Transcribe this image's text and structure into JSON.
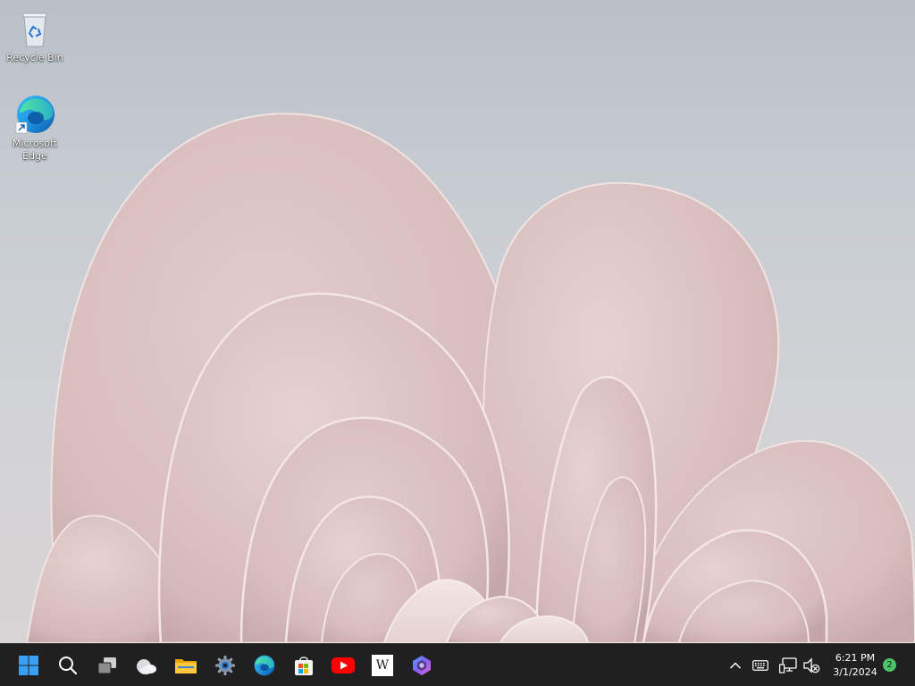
{
  "desktop": {
    "icons": [
      {
        "label": "Recycle Bin",
        "icon": "recycle-bin-icon"
      },
      {
        "label": "Microsoft Edge",
        "icon": "edge-icon"
      }
    ]
  },
  "taskbar": {
    "pinned": [
      {
        "name": "Start",
        "icon": "windows-start-icon"
      },
      {
        "name": "Search",
        "icon": "search-icon"
      },
      {
        "name": "Task View",
        "icon": "task-view-icon"
      },
      {
        "name": "Widgets",
        "icon": "weather-widget-icon"
      },
      {
        "name": "File Explorer",
        "icon": "folder-icon"
      },
      {
        "name": "Settings",
        "icon": "gear-icon"
      },
      {
        "name": "Microsoft Edge",
        "icon": "edge-icon"
      },
      {
        "name": "Microsoft Store",
        "icon": "store-icon"
      },
      {
        "name": "YouTube",
        "icon": "youtube-icon"
      },
      {
        "name": "Wikipedia",
        "icon": "wikipedia-icon"
      },
      {
        "name": "Copilot",
        "icon": "copilot-icon"
      }
    ],
    "wiki_letter": "W",
    "tray": {
      "icons": [
        "chevron-up-icon",
        "keyboard-icon",
        "network-icon",
        "volume-muted-icon"
      ],
      "time": "6:21 PM",
      "date": "3/1/2024",
      "notification_count": "2"
    },
    "colors": {
      "background": "#202020",
      "accent": "#0078d4",
      "badge": "#4cc46a"
    }
  }
}
